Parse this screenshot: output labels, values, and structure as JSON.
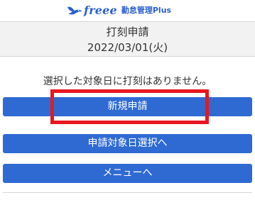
{
  "header": {
    "logo_word": "freee",
    "logo_subtitle": "勤怠管理Plus",
    "brand_color": "#2a5fd1"
  },
  "title": {
    "line1": "打刻申請",
    "date": "2022/03/01(火)"
  },
  "message": "選択した対象日に打刻はありません。",
  "buttons": {
    "new_request": "新規申請",
    "select_date": "申請対象日選択へ",
    "menu": "メニューへ"
  },
  "colors": {
    "button_bg": "#2f6ad3",
    "highlight_border": "#e8171f",
    "title_band_bg": "#f2f2f2"
  }
}
